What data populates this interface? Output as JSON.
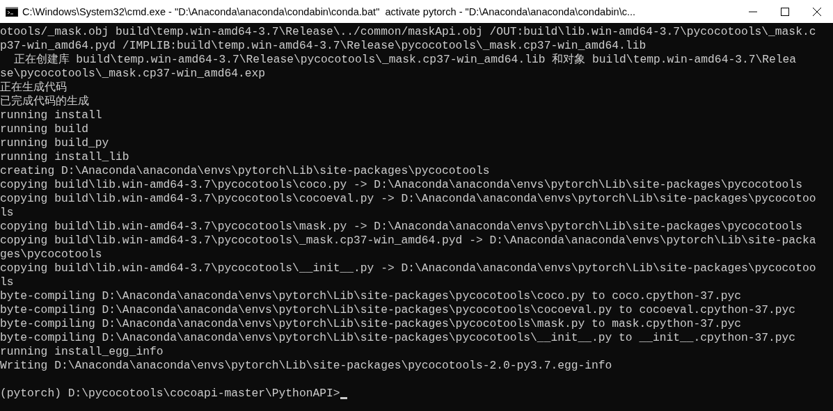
{
  "window": {
    "title": "C:\\Windows\\System32\\cmd.exe - \"D:\\Anaconda\\anaconda\\condabin\\conda.bat\"  activate pytorch - \"D:\\Anaconda\\anaconda\\condabin\\c..."
  },
  "console": {
    "lines": [
      {
        "kind": "output",
        "text": "otools/_mask.obj build\\temp.win-amd64-3.7\\Release\\../common/maskApi.obj /OUT:build\\lib.win-amd64-3.7\\pycocotools\\_mask.c"
      },
      {
        "kind": "output",
        "text": "p37-win_amd64.pyd /IMPLIB:build\\temp.win-amd64-3.7\\Release\\pycocotools\\_mask.cp37-win_amd64.lib"
      },
      {
        "kind": "output",
        "text": "  正在创建库 build\\temp.win-amd64-3.7\\Release\\pycocotools\\_mask.cp37-win_amd64.lib 和对象 build\\temp.win-amd64-3.7\\Relea"
      },
      {
        "kind": "output",
        "text": "se\\pycocotools\\_mask.cp37-win_amd64.exp"
      },
      {
        "kind": "output",
        "text": "正在生成代码"
      },
      {
        "kind": "output",
        "text": "已完成代码的生成"
      },
      {
        "kind": "output",
        "text": "running install"
      },
      {
        "kind": "output",
        "text": "running build"
      },
      {
        "kind": "output",
        "text": "running build_py"
      },
      {
        "kind": "output",
        "text": "running install_lib"
      },
      {
        "kind": "output",
        "text": "creating D:\\Anaconda\\anaconda\\envs\\pytorch\\Lib\\site-packages\\pycocotools"
      },
      {
        "kind": "output",
        "text": "copying build\\lib.win-amd64-3.7\\pycocotools\\coco.py -> D:\\Anaconda\\anaconda\\envs\\pytorch\\Lib\\site-packages\\pycocotools"
      },
      {
        "kind": "output",
        "text": "copying build\\lib.win-amd64-3.7\\pycocotools\\cocoeval.py -> D:\\Anaconda\\anaconda\\envs\\pytorch\\Lib\\site-packages\\pycocotoo"
      },
      {
        "kind": "output",
        "text": "ls"
      },
      {
        "kind": "output",
        "text": "copying build\\lib.win-amd64-3.7\\pycocotools\\mask.py -> D:\\Anaconda\\anaconda\\envs\\pytorch\\Lib\\site-packages\\pycocotools"
      },
      {
        "kind": "output",
        "text": "copying build\\lib.win-amd64-3.7\\pycocotools\\_mask.cp37-win_amd64.pyd -> D:\\Anaconda\\anaconda\\envs\\pytorch\\Lib\\site-packa"
      },
      {
        "kind": "output",
        "text": "ges\\pycocotools"
      },
      {
        "kind": "output",
        "text": "copying build\\lib.win-amd64-3.7\\pycocotools\\__init__.py -> D:\\Anaconda\\anaconda\\envs\\pytorch\\Lib\\site-packages\\pycocotoo"
      },
      {
        "kind": "output",
        "text": "ls"
      },
      {
        "kind": "output",
        "text": "byte-compiling D:\\Anaconda\\anaconda\\envs\\pytorch\\Lib\\site-packages\\pycocotools\\coco.py to coco.cpython-37.pyc"
      },
      {
        "kind": "output",
        "text": "byte-compiling D:\\Anaconda\\anaconda\\envs\\pytorch\\Lib\\site-packages\\pycocotools\\cocoeval.py to cocoeval.cpython-37.pyc"
      },
      {
        "kind": "output",
        "text": "byte-compiling D:\\Anaconda\\anaconda\\envs\\pytorch\\Lib\\site-packages\\pycocotools\\mask.py to mask.cpython-37.pyc"
      },
      {
        "kind": "output",
        "text": "byte-compiling D:\\Anaconda\\anaconda\\envs\\pytorch\\Lib\\site-packages\\pycocotools\\__init__.py to __init__.cpython-37.pyc"
      },
      {
        "kind": "output",
        "text": "running install_egg_info"
      },
      {
        "kind": "output",
        "text": "Writing D:\\Anaconda\\anaconda\\envs\\pytorch\\Lib\\site-packages\\pycocotools-2.0-py3.7.egg-info"
      },
      {
        "kind": "prompt",
        "text": "(pytorch) D:\\pycocotools\\cocoapi-master\\PythonAPI>"
      }
    ]
  }
}
